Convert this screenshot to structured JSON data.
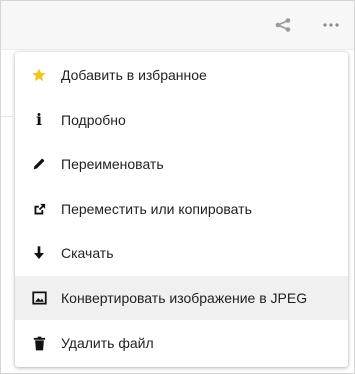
{
  "colors": {
    "accent_star": "#f5c518",
    "icon_dark": "#111111",
    "icon_muted": "#9a9a9a",
    "text": "#222222",
    "highlight": "#f0f0f0",
    "topbar": "#f7f7f7"
  },
  "topbar": {
    "share_icon": "share-icon",
    "more_icon": "more-horizontal-icon"
  },
  "menu": {
    "items": [
      {
        "label": "Добавить в избранное",
        "icon": "star-icon"
      },
      {
        "label": "Подробно",
        "icon": "info-icon"
      },
      {
        "label": "Переименовать",
        "icon": "pencil-icon"
      },
      {
        "label": "Переместить или копировать",
        "icon": "move-copy-icon"
      },
      {
        "label": "Скачать",
        "icon": "download-icon"
      },
      {
        "label": "Конвертировать изображение в JPEG",
        "icon": "image-icon",
        "highlighted": true
      },
      {
        "label": "Удалить файл",
        "icon": "trash-icon"
      }
    ]
  }
}
